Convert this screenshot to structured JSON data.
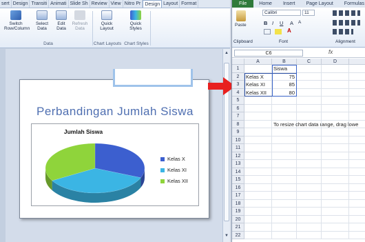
{
  "ppt": {
    "tabs": [
      "sert",
      "Design",
      "Transiti",
      "Animati",
      "Slide Sh",
      "Review",
      "View",
      "Nitro Pr",
      "Design",
      "Layout",
      "Format"
    ],
    "active_tab_index": 8,
    "ribbon": {
      "switch": "Switch\nRow/Column",
      "select": "Select\nData",
      "edit": "Edit\nData",
      "refresh": "Refresh\nData",
      "data_group": "Data",
      "quick_layout": "Quick\nLayout",
      "quick_styles": "Quick\nStyles",
      "layouts_group": "Chart Layouts",
      "styles_group": "Chart Styles"
    },
    "slide": {
      "title": "Perbandingan  Jumlah Siswa"
    },
    "chart_data": {
      "type": "pie",
      "title": "Jumlah Siswa",
      "categories": [
        "Kelas X",
        "Kelas XI",
        "Kelas XII"
      ],
      "values": [
        75,
        85,
        80
      ],
      "colors": [
        "#3c5fcf",
        "#3bb5e4",
        "#8fd43b"
      ],
      "legend": "right"
    }
  },
  "excel": {
    "tabs": [
      "File",
      "Home",
      "Insert",
      "Page Layout",
      "Formulas"
    ],
    "ribbon": {
      "paste": "Paste",
      "font_name": "Calibri",
      "font_size": "11",
      "clipboard_group": "Clipboard",
      "font_group": "Font",
      "alignment_group": "Alignment"
    },
    "name_box": "C6",
    "fx": "fx",
    "columns": [
      "A",
      "B",
      "C",
      "D"
    ],
    "rows": [
      [
        "",
        "Siswa",
        "",
        ""
      ],
      [
        "Kelas X",
        "75",
        "",
        ""
      ],
      [
        "Kelas XI",
        "85",
        "",
        ""
      ],
      [
        "Kelas XII",
        "80",
        "",
        ""
      ],
      [
        "",
        "",
        "",
        ""
      ],
      [
        "",
        "",
        "",
        ""
      ],
      [
        "",
        "",
        "",
        ""
      ],
      [
        "",
        "To resize chart data range, drag lowe",
        "",
        ""
      ],
      [
        "",
        "",
        "",
        ""
      ],
      [
        "",
        "",
        "",
        ""
      ],
      [
        "",
        "",
        "",
        ""
      ],
      [
        "",
        "",
        "",
        ""
      ],
      [
        "",
        "",
        "",
        ""
      ],
      [
        "",
        "",
        "",
        ""
      ],
      [
        "",
        "",
        "",
        ""
      ],
      [
        "",
        "",
        "",
        ""
      ],
      [
        "",
        "",
        "",
        ""
      ],
      [
        "",
        "",
        "",
        ""
      ],
      [
        "",
        "",
        "",
        ""
      ],
      [
        "",
        "",
        "",
        ""
      ],
      [
        "",
        "",
        "",
        ""
      ],
      [
        "",
        "",
        "",
        ""
      ]
    ]
  }
}
